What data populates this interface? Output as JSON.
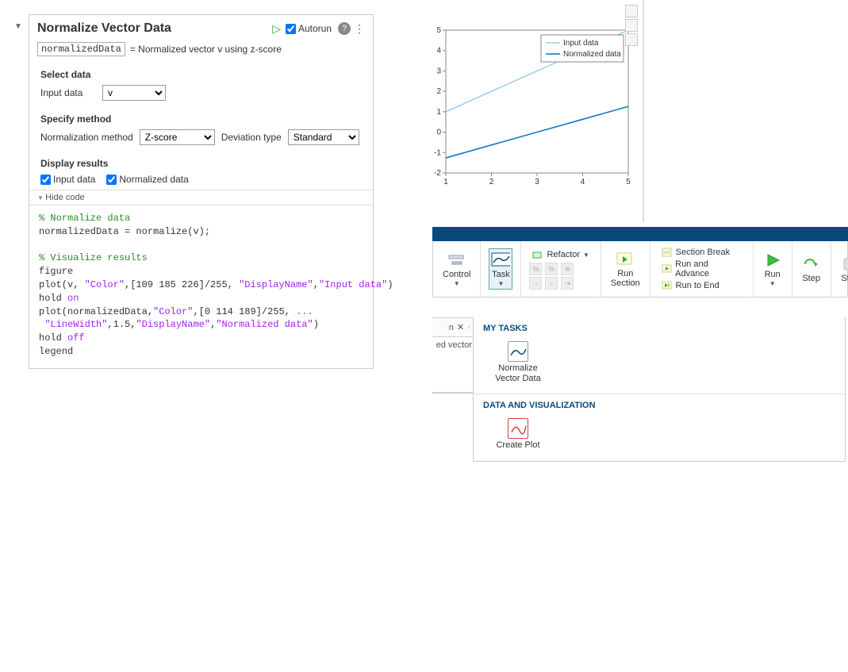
{
  "task": {
    "title": "Normalize Vector Data",
    "autorun_label": "Autorun",
    "autorun_checked": true,
    "output_var": "normalizedData",
    "output_desc": "= Normalized vector v using z-score",
    "sections": {
      "select_data": {
        "heading": "Select data",
        "input_label": "Input data",
        "input_value": "v"
      },
      "specify_method": {
        "heading": "Specify method",
        "norm_label": "Normalization method",
        "norm_value": "Z-score",
        "dev_label": "Deviation type",
        "dev_value": "Standard"
      },
      "display_results": {
        "heading": "Display results",
        "cb1_label": "Input data",
        "cb1_checked": true,
        "cb2_label": "Normalized data",
        "cb2_checked": true
      }
    },
    "hide_code_label": "Hide code",
    "code": {
      "c1": "% Normalize data",
      "l1a": "normalizedData = normalize(v);",
      "c2": "% Visualize results",
      "l2": "figure",
      "l3a": "plot(v, ",
      "l3s1": "\"Color\"",
      "l3b": ",[109 185 226]/255, ",
      "l3s2": "\"DisplayName\"",
      "l3c": ",",
      "l3s3": "\"Input data\"",
      "l3d": ")",
      "l4a": "hold ",
      "l4b": "on",
      "l5a": "plot(normalizedData,",
      "l5s1": "\"Color\"",
      "l5b": ",[0 114 189]/255, ",
      "l5s2": "...",
      "l6a": " ",
      "l6s1": "\"LineWidth\"",
      "l6b": ",1.5,",
      "l6s2": "\"DisplayName\"",
      "l6c": ",",
      "l6s3": "\"Normalized data\"",
      "l6d": ")",
      "l7a": "hold ",
      "l7b": "off",
      "l8": "legend"
    }
  },
  "chart_data": {
    "type": "line",
    "x": [
      1,
      2,
      3,
      4,
      5
    ],
    "series": [
      {
        "name": "Input data",
        "values": [
          1,
          2,
          3,
          4,
          5
        ],
        "color": "#6db9e2",
        "width": 1
      },
      {
        "name": "Normalized data",
        "values": [
          -1.26,
          -0.63,
          0,
          0.63,
          1.26
        ],
        "color": "#0072bd",
        "width": 1.5
      }
    ],
    "xlim": [
      1,
      5
    ],
    "ylim": [
      -2,
      5
    ],
    "xticks": [
      1,
      2,
      3,
      4,
      5
    ],
    "yticks": [
      -2,
      -1,
      0,
      1,
      2,
      3,
      4,
      5
    ],
    "legend_pos": "top-right"
  },
  "ribbon": {
    "control": "Control",
    "task": "Task",
    "refactor": "Refactor",
    "run_section": "Run Section",
    "section_break": "Section Break",
    "run_advance": "Run and Advance",
    "run_to_end": "Run to End",
    "run": "Run",
    "step": "Step",
    "stop": "Stop"
  },
  "task_dropdown": {
    "my_tasks": "MY TASKS",
    "normalize": "Normalize Vector Data",
    "data_vis": "DATA AND VISUALIZATION",
    "create_plot": "Create Plot"
  },
  "fragments": {
    "tabstub": "n",
    "bodystub": "ed vector"
  }
}
